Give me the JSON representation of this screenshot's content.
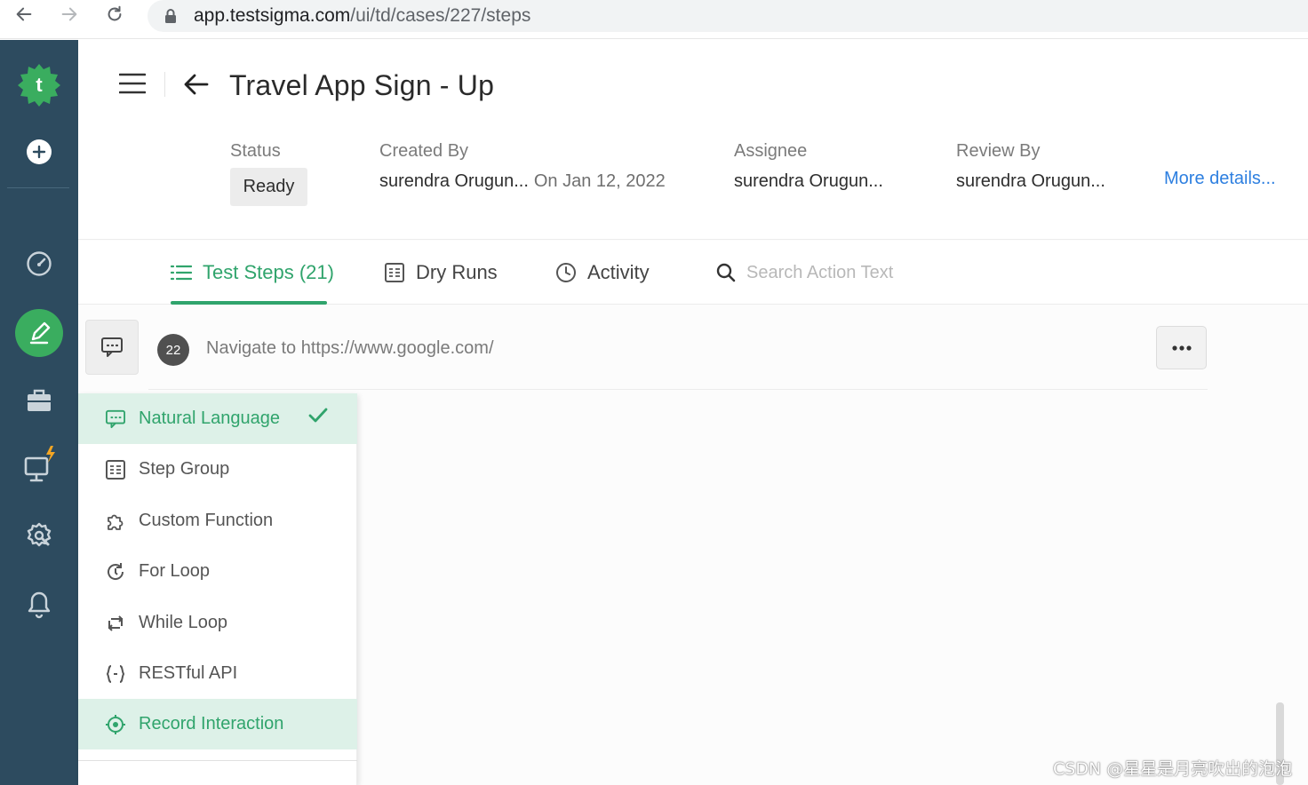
{
  "browser": {
    "url_host": "app.testsigma.com",
    "url_path": "/ui/td/cases/227/steps"
  },
  "sidebar": {
    "items": [
      {
        "icon": "testsigma-logo-icon"
      },
      {
        "icon": "plus-circle-icon"
      },
      {
        "icon": "dashboard-gauge-icon"
      },
      {
        "icon": "edit-pencil-icon"
      },
      {
        "icon": "briefcase-icon"
      },
      {
        "icon": "monitor-icon"
      },
      {
        "icon": "settings-gear-icon"
      },
      {
        "icon": "bell-icon"
      }
    ],
    "colors": {
      "background": "#2d4b5f",
      "active": "#3aad5f",
      "flash": "#f5a623"
    }
  },
  "header": {
    "title": "Travel App Sign - Up",
    "status_label": "Status",
    "status_value": "Ready",
    "created_by_label": "Created By",
    "created_by_value": "surendra Orugun...",
    "created_on": "On Jan 12, 2022",
    "assignee_label": "Assignee",
    "assignee_value": "surendra Orugun...",
    "review_by_label": "Review By",
    "review_by_value": "surendra Orugun...",
    "more_details": "More details..."
  },
  "tabs": {
    "test_steps": "Test Steps (21)",
    "dry_runs": "Dry Runs",
    "activity": "Activity",
    "search_placeholder": "Search Action Text"
  },
  "step": {
    "number": "22",
    "text": "Navigate to https://www.google.com/",
    "more": "•••"
  },
  "dropdown": {
    "items": [
      {
        "label": "Natural Language",
        "icon": "natural-language-icon",
        "selected": true
      },
      {
        "label": "Step Group",
        "icon": "step-group-icon"
      },
      {
        "label": "Custom Function",
        "icon": "puzzle-icon"
      },
      {
        "label": "For Loop",
        "icon": "for-loop-icon"
      },
      {
        "label": "While Loop",
        "icon": "while-loop-icon"
      },
      {
        "label": "RESTful API",
        "icon": "braces-icon"
      },
      {
        "label": "Record Interaction",
        "icon": "record-target-icon",
        "highlighted": true
      }
    ],
    "accent_color": "#30a46c"
  },
  "watermark": "CSDN @星星是月亮吹出的泡泡"
}
